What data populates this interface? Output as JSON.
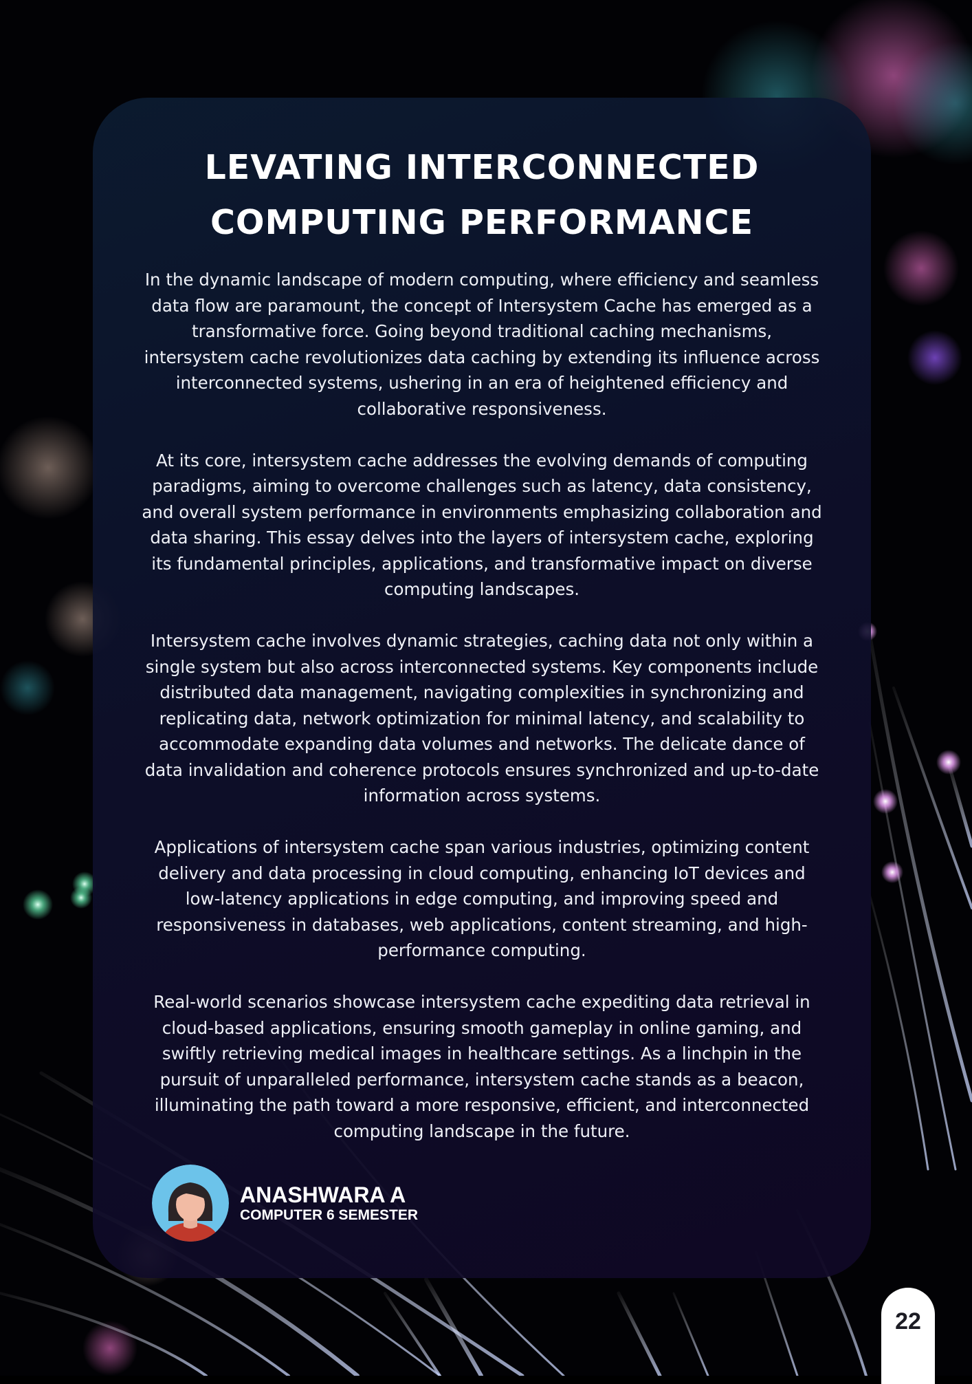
{
  "title": {
    "line1": "LEVATING INTERCONNECTED",
    "line2": "COMPUTING PERFORMANCE"
  },
  "paragraphs": [
    "In the dynamic landscape of modern computing, where efficiency and seamless data flow are paramount, the concept of Intersystem Cache has emerged as a transformative force. Going beyond traditional caching mechanisms, intersystem cache revolutionizes data caching by extending its influence across interconnected systems, ushering in an era of heightened efficiency and collaborative responsiveness.",
    "At its core, intersystem cache addresses the evolving demands of computing paradigms, aiming to overcome challenges such as latency, data consistency, and overall system performance in environments emphasizing collaboration and data sharing. This essay delves into the layers of intersystem cache, exploring its fundamental principles, applications, and transformative impact on diverse computing landscapes.",
    "Intersystem cache involves dynamic strategies, caching data not only within a single system but also across interconnected systems. Key components include distributed data management, navigating complexities in synchronizing and replicating data, network optimization for minimal latency, and scalability to accommodate expanding data volumes and networks. The delicate dance of data invalidation and coherence protocols ensures synchronized and up-to-date information across systems.",
    "Applications of intersystem cache span various industries, optimizing content delivery and data processing in cloud computing, enhancing IoT devices and low-latency applications in edge computing, and improving speed and responsiveness in databases, web applications, content streaming, and high-performance computing.",
    "Real-world scenarios showcase intersystem cache expediting data retrieval in cloud-based applications, ensuring smooth gameplay in online gaming, and swiftly retrieving medical images in healthcare settings. As a linchpin in the pursuit of unparalleled performance, intersystem cache stands as a beacon, illuminating the path toward a more responsive, efficient, and interconnected computing landscape in the future."
  ],
  "author": {
    "name": "ANASHWARA A",
    "subtitle": "COMPUTER 6 SEMESTER",
    "avatar_icon": "woman-avatar-icon"
  },
  "page_number": "22",
  "colors": {
    "background": "#000000",
    "card": "#0f1430",
    "text": "#ffffff",
    "avatar_bg": "#6cc3ea",
    "avatar_shirt": "#c0392b"
  }
}
